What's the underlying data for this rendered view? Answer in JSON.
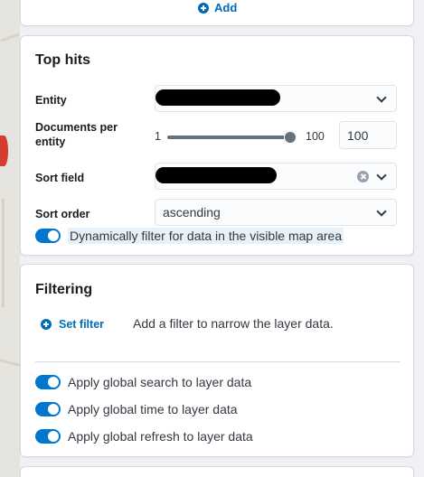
{
  "add_section": {
    "add_label": "Add"
  },
  "top_hits": {
    "title": "Top hits",
    "entity": {
      "label": "Entity"
    },
    "documents_per_entity": {
      "label": "Documents per entity",
      "min": "1",
      "max": "100",
      "value": "100",
      "slider_fraction": 1.0
    },
    "sort_field": {
      "label": "Sort field"
    },
    "sort_order": {
      "label": "Sort order",
      "value": "ascending"
    },
    "dynamic_filter": {
      "label": "Dynamically filter for data in the visible map area",
      "on": true
    }
  },
  "filtering": {
    "title": "Filtering",
    "set_filter_label": "Set filter",
    "help_text": "Add a filter to narrow the layer data.",
    "switches": [
      {
        "label": "Apply global search to layer data",
        "on": true
      },
      {
        "label": "Apply global time to layer data",
        "on": true
      },
      {
        "label": "Apply global refresh to layer data",
        "on": true
      }
    ]
  },
  "colors": {
    "accent": "#0077cc",
    "link": "#006bb8",
    "border": "#d3dae6"
  }
}
